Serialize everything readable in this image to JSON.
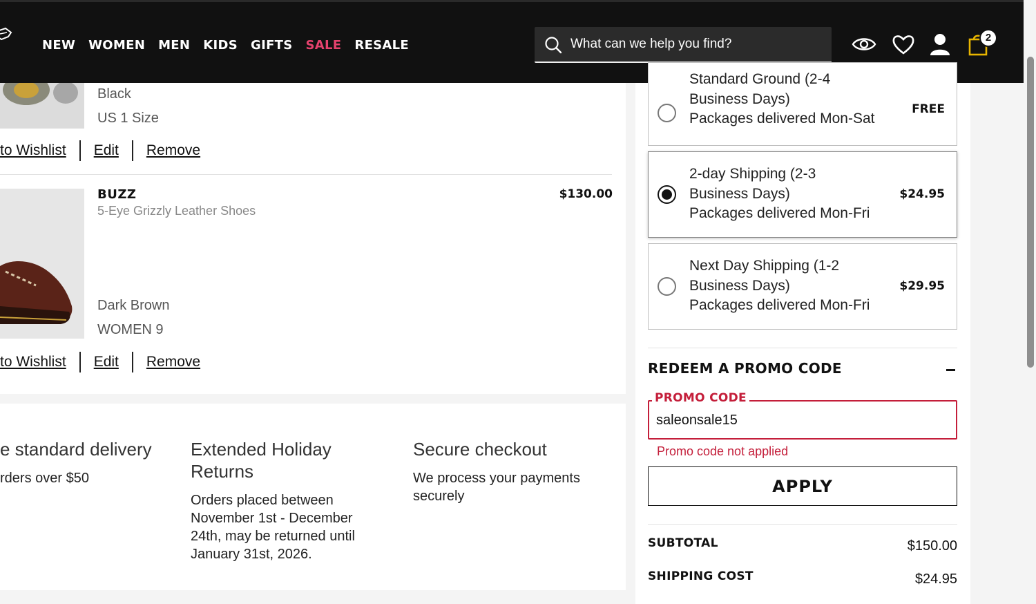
{
  "header": {
    "nav": [
      "NEW",
      "WOMEN",
      "MEN",
      "KIDS",
      "GIFTS",
      "SALE",
      "RESALE"
    ],
    "search_placeholder": "What can we help you find?",
    "bag_count": "2",
    "icons": [
      "search-icon",
      "eye-icon",
      "heart-icon",
      "user-icon",
      "bag-icon"
    ]
  },
  "cart": {
    "item1": {
      "color": "Black",
      "size": "US 1 Size",
      "wishlist": "to Wishlist",
      "edit": "Edit",
      "remove": "Remove"
    },
    "item2": {
      "name": "BUZZ",
      "description": "5-Eye Grizzly Leather Shoes",
      "price": "$130.00",
      "color": "Dark Brown",
      "size": "WOMEN 9",
      "wishlist": "to Wishlist",
      "edit": "Edit",
      "remove": "Remove"
    }
  },
  "benefits": {
    "b1_title": "e standard delivery",
    "b1_text": "rders over $50",
    "b2_title_1": "Extended Holiday",
    "b2_title_2": "Returns",
    "b2_text_1": "Orders placed between",
    "b2_text_2": "November 1st - December",
    "b2_text_3": "24th, may be returned until",
    "b2_text_4": "January 31st, 2026.",
    "b3_title": "Secure checkout",
    "b3_text_1": "We process your payments",
    "b3_text_2": "securely"
  },
  "shipping": {
    "options": [
      {
        "line0": "Standard Ground (2-4",
        "line1": "Business Days)",
        "line2": "Packages delivered Mon-Sat",
        "price": "FREE",
        "selected": false
      },
      {
        "line0": "2-day Shipping (2-3",
        "line1": "Business Days)",
        "line2": "Packages delivered Mon-Fri",
        "price": "$24.95",
        "selected": true
      },
      {
        "line0": "Next Day Shipping (1-2",
        "line1": "Business Days)",
        "line2": "Packages delivered Mon-Fri",
        "price": "$29.95",
        "selected": false
      }
    ]
  },
  "promo": {
    "heading": "REDEEM A PROMO CODE",
    "label": "PROMO CODE",
    "value": "saleonsale15",
    "error": "Promo code not applied",
    "apply": "APPLY"
  },
  "summary": {
    "subtotal_label": "SUBTOTAL",
    "subtotal_value": "$150.00",
    "shipping_label": "SHIPPING COST",
    "shipping_value": "$24.95"
  },
  "colors": {
    "brand_black": "#111111",
    "sale_pink": "#e6426e",
    "error_red": "#c41e3a"
  }
}
